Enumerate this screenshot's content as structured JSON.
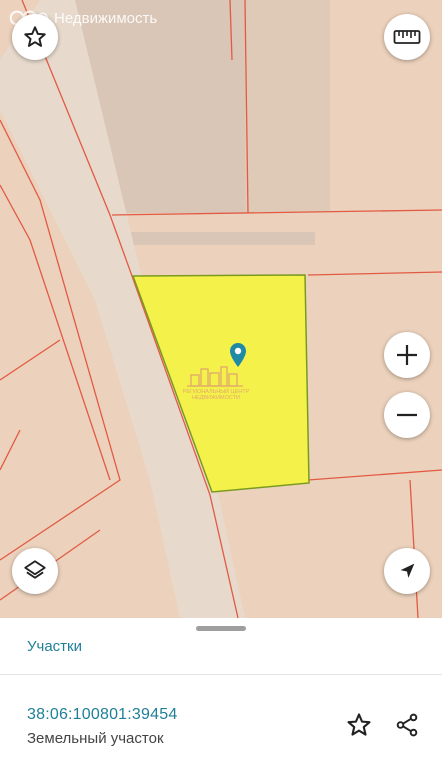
{
  "app": {
    "brand_text": "Недвижимость"
  },
  "map": {
    "colors": {
      "land": "#ecd2bc",
      "road": "#e7dacc",
      "shadow": "#b9b1ab",
      "boundary": "#e25a43",
      "selected_fill": "#f4f24a",
      "selected_stroke": "#7a9a1f",
      "pin": "#1f8aa6"
    },
    "watermark_line1": "РЕГИОНАЛЬНЫЙ ЦЕНТР",
    "watermark_line2": "НЕДВИЖИМОСТИ"
  },
  "controls": {
    "favorite_icon": "star-outline",
    "ruler_icon": "ruler",
    "zoom_in_icon": "plus",
    "zoom_out_icon": "minus",
    "layers_icon": "layers",
    "locate_icon": "navigation-arrow"
  },
  "sheet": {
    "tab_label": "Участки",
    "parcel": {
      "cadastral_number": "38:06:100801:39454",
      "type": "Земельный участок"
    },
    "actions": {
      "favorite_icon": "star-outline",
      "share_icon": "share"
    },
    "accent": "#1f7f97"
  }
}
